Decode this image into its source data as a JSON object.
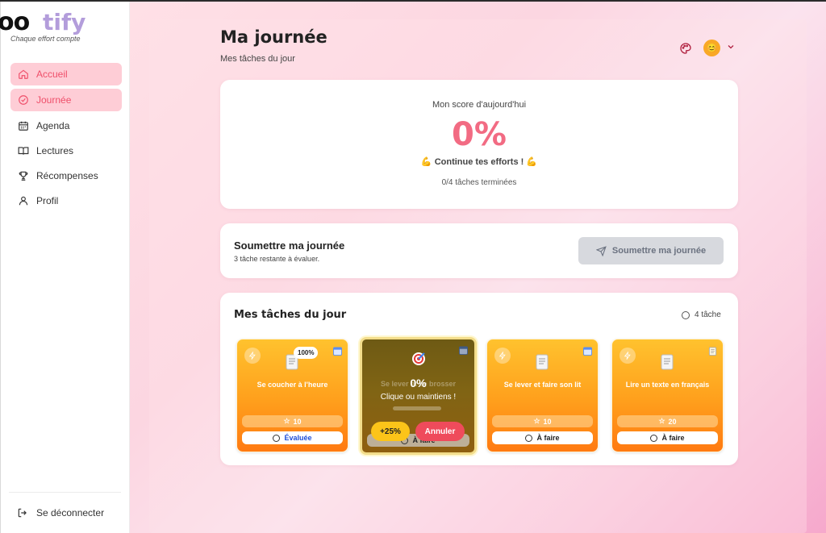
{
  "app": {
    "logo_dark": "oo",
    "logo_light": "tify",
    "tagline": "Chaque effort compte"
  },
  "sidebar": {
    "items": [
      {
        "label": "Accueil",
        "icon": "home-icon",
        "active": true
      },
      {
        "label": "Journée",
        "icon": "check-circle-icon",
        "active": true
      },
      {
        "label": "Agenda",
        "icon": "calendar-icon",
        "active": false
      },
      {
        "label": "Lectures",
        "icon": "book-icon",
        "active": false
      },
      {
        "label": "Récompenses",
        "icon": "trophy-icon",
        "active": false
      },
      {
        "label": "Profil",
        "icon": "user-icon",
        "active": false
      }
    ],
    "logout_label": "Se déconnecter"
  },
  "header": {
    "title": "Ma journée",
    "subtitle": "Mes tâches du jour",
    "avatar_emoji": "😊"
  },
  "score": {
    "label": "Mon score d'aujourd'hui",
    "value": "0%",
    "message": "Continue tes efforts !",
    "emoji": "💪",
    "count_text": "0/4 tâches terminées"
  },
  "submit": {
    "title": "Soumettre ma journée",
    "subtitle": "3 tâche restante à évaluer.",
    "button_label": "Soumettre ma journée"
  },
  "tasks": {
    "title": "Mes tâches du jour",
    "count_text": "4 tâche",
    "items": [
      {
        "title": "Se coucher à l'heure",
        "points": "10",
        "status": "Évaluée",
        "badge": "100%"
      },
      {
        "title": "Se lever et se brosser",
        "points": "",
        "status": "À faire",
        "progress_text": "0%",
        "progress": 0,
        "hint": "Clique ou maintiens !",
        "plus_label": "+25%",
        "cancel_label": "Annuler"
      },
      {
        "title": "Se lever et faire son lit",
        "points": "10",
        "status": "À faire"
      },
      {
        "title": "Lire un texte en français",
        "points": "20",
        "status": "À faire"
      }
    ]
  },
  "colors": {
    "accent": "#f26b83",
    "active_bg": "#fecdd6",
    "task_orange": "#ff9f1c",
    "task_yellow": "#ffc22e"
  }
}
